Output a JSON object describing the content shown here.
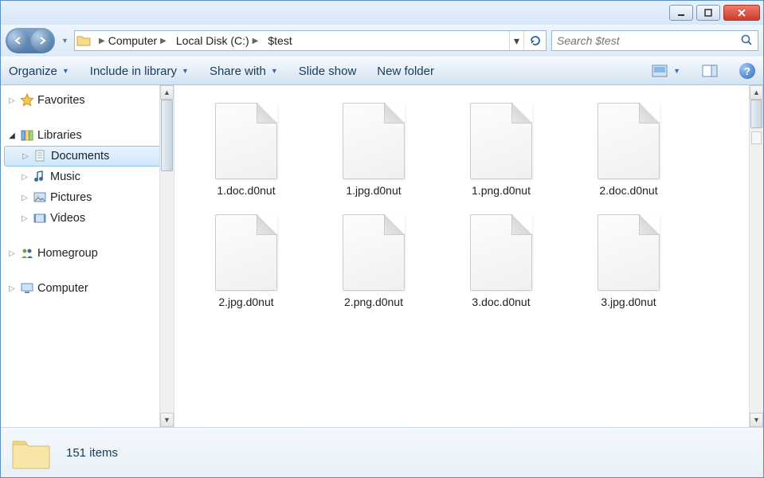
{
  "titlebar": {},
  "nav": {
    "breadcrumb": [
      "Computer",
      "Local Disk (C:)",
      "$test"
    ]
  },
  "search": {
    "placeholder": "Search $test"
  },
  "toolbar": {
    "organize": "Organize",
    "include": "Include in library",
    "share": "Share with",
    "slideshow": "Slide show",
    "newfolder": "New folder"
  },
  "sidebar": {
    "favorites": "Favorites",
    "libraries": "Libraries",
    "documents": "Documents",
    "music": "Music",
    "pictures": "Pictures",
    "videos": "Videos",
    "homegroup": "Homegroup",
    "computer": "Computer"
  },
  "files": [
    "1.doc.d0nut",
    "1.jpg.d0nut",
    "1.png.d0nut",
    "2.doc.d0nut",
    "2.jpg.d0nut",
    "2.png.d0nut",
    "3.doc.d0nut",
    "3.jpg.d0nut"
  ],
  "status": {
    "count": "151 items"
  }
}
